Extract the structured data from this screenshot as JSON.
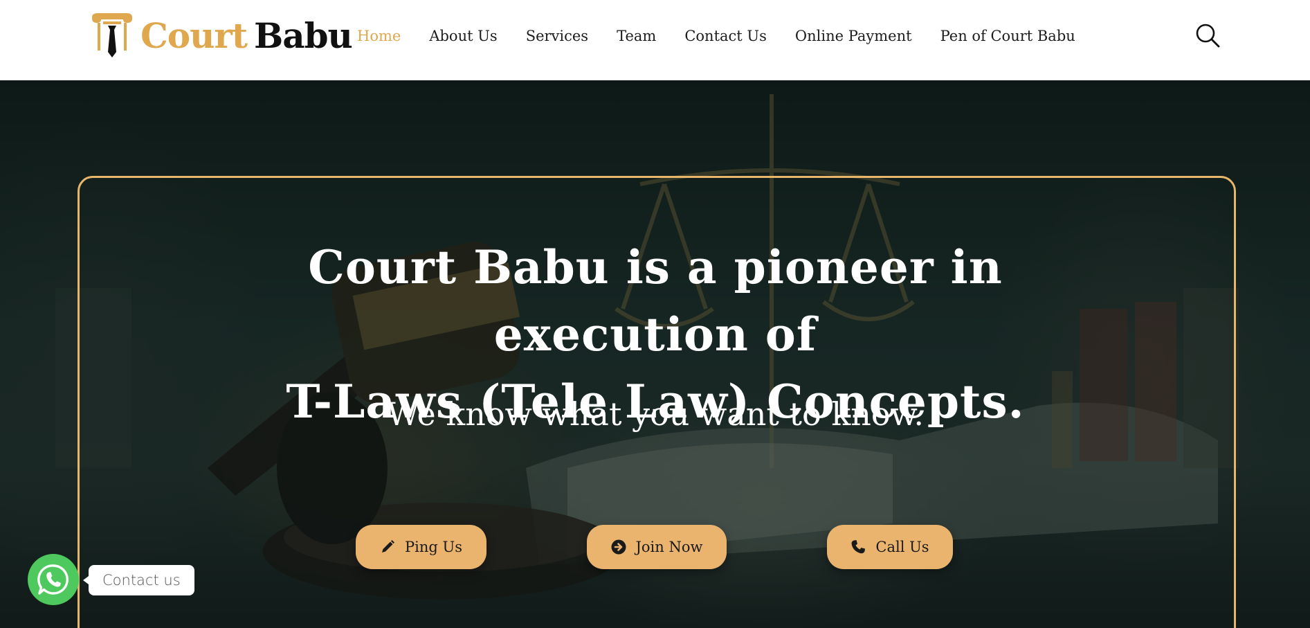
{
  "brand": {
    "name_part1": "Court",
    "name_part2": "Babu",
    "logo_icon": "pillar-tie-icon"
  },
  "nav": {
    "items": [
      {
        "label": "Home",
        "active": true
      },
      {
        "label": "About Us",
        "active": false
      },
      {
        "label": "Services",
        "active": false
      },
      {
        "label": "Team",
        "active": false
      },
      {
        "label": "Contact Us",
        "active": false
      },
      {
        "label": "Online Payment",
        "active": false
      },
      {
        "label": "Pen of Court Babu",
        "active": false
      }
    ],
    "search_icon": "search-icon"
  },
  "hero": {
    "headline_line1": "Court Babu is a pioneer in execution of",
    "headline_line2": "T-Laws (Tele Law) Concepts.",
    "tagline": "We know what you want to know.",
    "buttons": [
      {
        "label": "Ping Us",
        "icon": "pencil-icon"
      },
      {
        "label": "Join Now",
        "icon": "arrow-circle-right-icon"
      },
      {
        "label": "Call Us",
        "icon": "phone-icon"
      }
    ]
  },
  "whatsapp": {
    "label": "Contact us",
    "icon": "whatsapp-icon"
  },
  "colors": {
    "accent": "#e0a84e",
    "button_bg": "#eab46e",
    "whatsapp": "#4ec95d",
    "text_dark": "#1d1d1d"
  }
}
